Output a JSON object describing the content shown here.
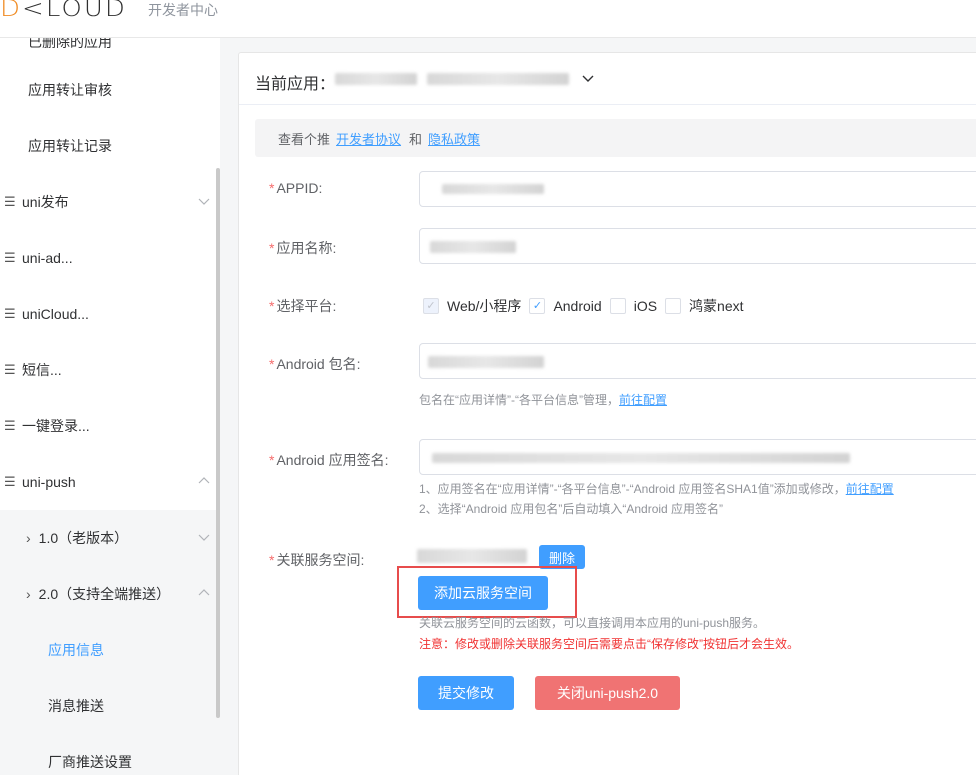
{
  "header": {
    "logo_text": "DCLOUD",
    "subtitle": "开发者中心"
  },
  "sidebar": {
    "top_partial": "已删除的应用",
    "items": [
      {
        "label": "应用转让审核",
        "icon": "none"
      },
      {
        "label": "应用转让记录",
        "icon": "none"
      },
      {
        "label": "uni发布",
        "icon": "list-icon",
        "chevron": "down"
      },
      {
        "label": "uni-ad...",
        "icon": "list-icon"
      },
      {
        "label": "uniCloud...",
        "icon": "list-icon"
      },
      {
        "label": "短信...",
        "icon": "list-icon"
      },
      {
        "label": "一键登录...",
        "icon": "list-icon"
      },
      {
        "label": "uni-push",
        "icon": "list-icon",
        "chevron": "up"
      },
      {
        "label": "1.0（老版本）",
        "chevron": "down"
      },
      {
        "label": "2.0（支持全端推送）",
        "chevron": "up"
      },
      {
        "label": "应用信息",
        "active": true
      },
      {
        "label": "消息推送"
      },
      {
        "label": "厂商推送设置"
      }
    ]
  },
  "main": {
    "current_app_label": "当前应用：",
    "notice_prefix": "查看个推",
    "notice_link1": "开发者协议",
    "notice_and": "和",
    "notice_link2": "隐私政策",
    "fields": {
      "appid_label": "APPID:",
      "app_name_label": "应用名称:",
      "platform_label": "选择平台:",
      "package_label": "Android 包名:",
      "signature_label": "Android 应用签名:",
      "service_label": "关联服务空间:"
    },
    "platforms": [
      {
        "label": "Web/小程序",
        "checked": true,
        "disabled": true
      },
      {
        "label": "Android",
        "checked": true,
        "disabled": false
      },
      {
        "label": "iOS",
        "checked": false,
        "disabled": false
      },
      {
        "label": "鸿蒙next",
        "checked": false,
        "disabled": false
      }
    ],
    "package_help": "包名在“应用详情”-“各平台信息”管理，",
    "package_help_link": "前往配置",
    "signature_help1": "1、应用签名在“应用详情”-“各平台信息”-“Android 应用签名SHA1值”添加或修改，",
    "signature_help1_link": "前往配置",
    "signature_help2": "2、选择“Android 应用包名”后自动填入“Android 应用签名”",
    "delete_label": "删除",
    "add_space_label": "添加云服务空间",
    "space_help": "关联云服务空间的云函数，可以直接调用本应用的uni-push服务。",
    "space_warning": "注意：修改或删除关联服务空间后需要点击“保存修改”按钮后才会生效。",
    "submit_label": "提交修改",
    "close_label": "关闭uni-push2.0"
  },
  "colors": {
    "primary": "#409eff",
    "danger": "#f07373",
    "required": "#f56c6c",
    "highlight": "#e74c4c"
  }
}
